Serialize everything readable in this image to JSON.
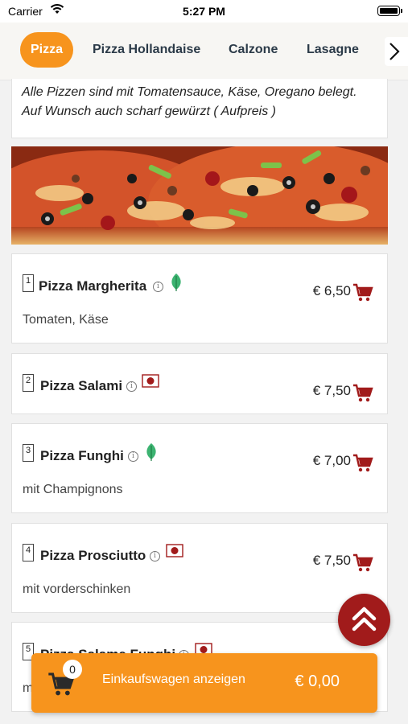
{
  "status_bar": {
    "carrier": "Carrier",
    "time": "5:27 PM"
  },
  "tabs": [
    {
      "label": "Pizza",
      "active": true
    },
    {
      "label": "Pizza Hollandaise",
      "active": false
    },
    {
      "label": "Calzone",
      "active": false
    },
    {
      "label": "Lasagne",
      "active": false
    }
  ],
  "category_description": "Alle Pizzen sind mit Tomatensauce, Käse, Oregano belegt. Auf Wunsch auch scharf gewürzt ( Aufpreis )",
  "items": [
    {
      "number": "1",
      "name": "Pizza Margherita",
      "badge": "leaf-icon",
      "price": "€ 6,50",
      "description": "Tomaten, Käse"
    },
    {
      "number": "2",
      "name": "Pizza Salami",
      "badge": "meat-icon",
      "price": "€ 7,50",
      "description": ""
    },
    {
      "number": "3",
      "name": "Pizza Funghi",
      "badge": "leaf-icon",
      "price": "€ 7,00",
      "description": "mit Champignons"
    },
    {
      "number": "4",
      "name": "Pizza Prosciutto",
      "badge": "meat-icon",
      "price": "€ 7,50",
      "description": "mit vorderschinken"
    },
    {
      "number": "5",
      "name": "Pizza Salame Funghi",
      "badge": "meat-icon",
      "price": "",
      "description": "m"
    }
  ],
  "cart": {
    "count": "0",
    "label": "Einkaufswagen anzeigen",
    "total": "€ 0,00"
  },
  "colors": {
    "accent": "#f7941d",
    "cart_red": "#a11b1b",
    "leaf_green": "#3cb371"
  }
}
